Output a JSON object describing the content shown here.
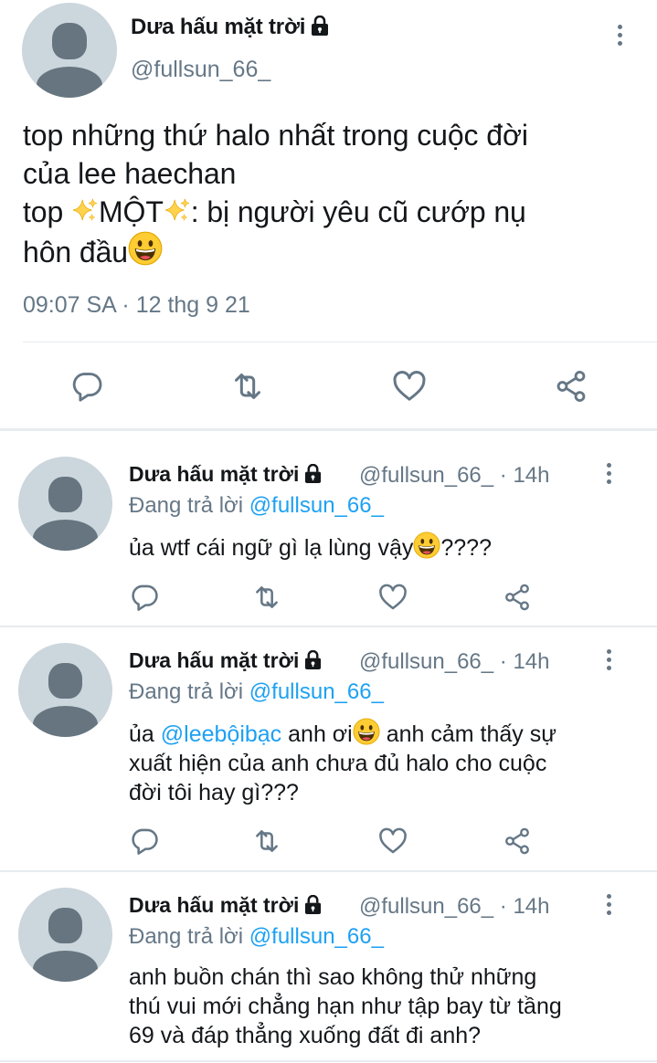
{
  "colors": {
    "muted": "#657786",
    "accent": "#1da1f2",
    "avatar_bg": "#ccd6dd",
    "divider": "#e6ecf0"
  },
  "main_tweet": {
    "display_name": "Dưa hấu mặt trời",
    "handle": "@fullsun_66_",
    "text_line1": "top những thứ halo nhất trong cuộc đời",
    "text_line2": "của lee haechan",
    "text_line3_pre": "top ",
    "text_line3_mid": "MỘT",
    "text_line3_post": ": bị người yêu cũ cướp nụ",
    "text_line4": "hôn đầu",
    "timestamp": "09:07 SA · 12 thg 9 21",
    "actions": [
      "reply-icon",
      "retweet-icon",
      "like-icon",
      "share-icon"
    ]
  },
  "replies": [
    {
      "display_name": "Dưa hấu mặt trời",
      "meta": "@fullsun_66_ · 14h",
      "replying_label": "Đang trả lời",
      "replying_to": "@fullsun_66_",
      "text_a": "ủa wtf cái ngữ gì lạ lùng vậy",
      "text_b": "????"
    },
    {
      "display_name": "Dưa hấu mặt trời",
      "meta": "@fullsun_66_ · 14h",
      "replying_label": "Đang trả lời",
      "replying_to": "@fullsun_66_",
      "text_a": "ủa ",
      "mention": "@leebộibạc",
      "text_b": " anh ơi",
      "text_c": " anh cảm thấy sự",
      "text_d": "xuất hiện của anh chưa đủ halo cho cuộc",
      "text_e": "đời tôi hay gì???"
    },
    {
      "display_name": "Dưa hấu mặt trời",
      "meta": "@fullsun_66_ · 14h",
      "replying_label": "Đang trả lời",
      "replying_to": "@fullsun_66_",
      "text_a": "anh buồn chán thì sao không thử những",
      "text_b": "thú vui mới chẳng hạn như tập bay từ tầng",
      "text_c": "69 và đáp thẳng xuống đất đi anh?"
    }
  ]
}
